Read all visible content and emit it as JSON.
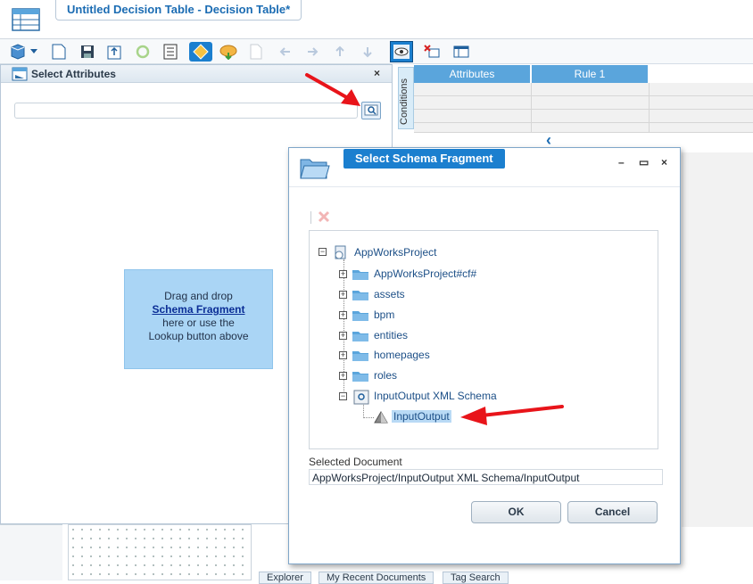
{
  "document_tab": {
    "title": "Untitled Decision Table - Decision Table*"
  },
  "toolbar": {
    "icons": [
      "insert-table-icon",
      "dropdown-icon",
      "new-document-icon",
      "save-icon",
      "publish-icon",
      "refresh-icon",
      "properties-icon",
      "diamond-rule-icon",
      "cloud-deploy-icon",
      "blank-page-icon",
      "move-left-icon",
      "move-right-icon",
      "move-up-icon",
      "move-down-icon",
      "view-attributes-icon",
      "delete-column-icon",
      "table-view-icon"
    ]
  },
  "attributes_panel": {
    "title": "Select Attributes",
    "close": "×",
    "drop_zone": {
      "line1": "Drag and drop",
      "link": "Schema Fragment",
      "line2": "here or use the",
      "line3": "Lookup button above"
    }
  },
  "decision_table": {
    "side_label": "Conditions",
    "columns": [
      "Attributes",
      "Rule 1"
    ],
    "nav_glyph": "‹"
  },
  "bottom_tabs": [
    "Explorer",
    "My Recent Documents",
    "Tag Search"
  ],
  "dialog": {
    "title": "Select Schema Fragment",
    "controls": [
      "–",
      "▭",
      "×"
    ],
    "tree": {
      "root": "AppWorksProject",
      "children": [
        "AppWorksProject#cf#",
        "assets",
        "bpm",
        "entities",
        "homepages",
        "roles",
        "InputOutput XML Schema"
      ],
      "selected_leaf": "InputOutput"
    },
    "selected_document_label": "Selected Document",
    "selected_document_value": "AppWorksProject/InputOutput XML Schema/InputOutput",
    "ok_label": "OK",
    "cancel_label": "Cancel"
  },
  "colors": {
    "accent": "#1b7fcf",
    "header_blue": "#5aa5dc",
    "drop_zone": "#aad5f5",
    "arrow_red": "#e8141a"
  }
}
